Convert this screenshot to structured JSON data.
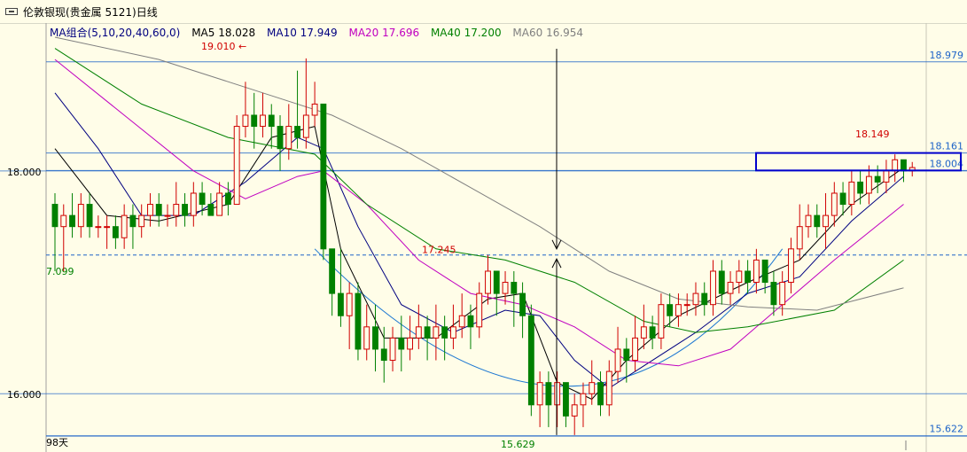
{
  "window": {
    "title": "伦敦银现(贵金属 5121)日线"
  },
  "ma_legend": [
    {
      "label": "MA组合(5,10,20,40,60,0)",
      "color": "#000080"
    },
    {
      "label": "MA5 18.028",
      "color": "#000000"
    },
    {
      "label": "MA10 17.949",
      "color": "#000080"
    },
    {
      "label": "MA20 17.696",
      "color": "#c000c0"
    },
    {
      "label": "MA40 17.200",
      "color": "#008000"
    },
    {
      "label": "MA60 16.954",
      "color": "#808080"
    }
  ],
  "colors": {
    "up": "#d00000",
    "down": "#008000",
    "grid": "#1e64c8",
    "annotation_box": "#0000cc",
    "arc": "#1e78d2"
  },
  "chart_data": {
    "type": "candlestick",
    "ylim": [
      15.62,
      19.2
    ],
    "y_ticks": [
      {
        "value": 18.0,
        "label": "18.000"
      },
      {
        "value": 16.0,
        "label": "16.000"
      }
    ],
    "right_labels": [
      {
        "value": 18.979,
        "label": "18.979",
        "color": "#1e64c8"
      },
      {
        "value": 18.161,
        "label": "18.161",
        "color": "#1e64c8"
      },
      {
        "value": 18.004,
        "label": "18.004",
        "color": "#1e64c8"
      },
      {
        "value": 15.622,
        "label": "15.622",
        "color": "#1e64c8"
      }
    ],
    "left_labels": [
      {
        "value": 17.099,
        "label": "7.099",
        "color": "#008000"
      }
    ],
    "annotations": [
      {
        "label": "19.010",
        "value": 19.01,
        "color": "#d00000"
      },
      {
        "label": "17.245",
        "value": 17.245,
        "color": "#d00000"
      },
      {
        "label": "18.149",
        "value": 18.149,
        "color": "#d00000"
      },
      {
        "label": "15.629",
        "value": 15.629,
        "color": "#008000"
      }
    ],
    "footer": "98天",
    "dashed_level": 17.245,
    "candles": [
      [
        17.7,
        17.5,
        17.8,
        17.1
      ],
      [
        17.5,
        17.6,
        17.7,
        17.1
      ],
      [
        17.6,
        17.5,
        17.8,
        17.4
      ],
      [
        17.5,
        17.7,
        17.8,
        17.4
      ],
      [
        17.7,
        17.5,
        17.8,
        17.4
      ],
      [
        17.5,
        17.5,
        17.6,
        17.4
      ],
      [
        17.5,
        17.5,
        17.6,
        17.3
      ],
      [
        17.5,
        17.4,
        17.6,
        17.3
      ],
      [
        17.4,
        17.6,
        17.7,
        17.3
      ],
      [
        17.6,
        17.5,
        17.7,
        17.3
      ],
      [
        17.5,
        17.6,
        17.7,
        17.4
      ],
      [
        17.6,
        17.7,
        17.8,
        17.5
      ],
      [
        17.7,
        17.6,
        17.8,
        17.5
      ],
      [
        17.6,
        17.6,
        17.7,
        17.5
      ],
      [
        17.6,
        17.7,
        17.9,
        17.5
      ],
      [
        17.7,
        17.6,
        17.8,
        17.5
      ],
      [
        17.6,
        17.8,
        17.9,
        17.5
      ],
      [
        17.8,
        17.7,
        17.9,
        17.6
      ],
      [
        17.7,
        17.6,
        17.8,
        17.6
      ],
      [
        17.6,
        17.8,
        17.9,
        17.6
      ],
      [
        17.8,
        17.7,
        17.9,
        17.6
      ],
      [
        17.7,
        18.4,
        18.5,
        17.7
      ],
      [
        18.4,
        18.5,
        18.8,
        18.3
      ],
      [
        18.5,
        18.4,
        18.7,
        18.2
      ],
      [
        18.4,
        18.5,
        18.7,
        18.3
      ],
      [
        18.5,
        18.4,
        18.6,
        18.2
      ],
      [
        18.4,
        18.2,
        18.5,
        18.0
      ],
      [
        18.2,
        18.4,
        18.6,
        18.1
      ],
      [
        18.4,
        18.3,
        18.9,
        18.2
      ],
      [
        18.3,
        18.5,
        19.01,
        18.2
      ],
      [
        18.5,
        18.6,
        18.8,
        18.4
      ],
      [
        18.6,
        17.3,
        18.6,
        17.2
      ],
      [
        17.3,
        16.9,
        17.3,
        16.7
      ],
      [
        16.9,
        16.7,
        17.3,
        16.6
      ],
      [
        16.7,
        16.9,
        17.0,
        16.4
      ],
      [
        16.9,
        16.4,
        17.0,
        16.3
      ],
      [
        16.4,
        16.6,
        16.8,
        16.3
      ],
      [
        16.6,
        16.4,
        16.8,
        16.2
      ],
      [
        16.4,
        16.3,
        16.6,
        16.1
      ],
      [
        16.3,
        16.5,
        16.6,
        16.2
      ],
      [
        16.5,
        16.4,
        16.7,
        16.2
      ],
      [
        16.4,
        16.5,
        16.7,
        16.3
      ],
      [
        16.5,
        16.6,
        16.8,
        16.4
      ],
      [
        16.6,
        16.5,
        16.7,
        16.3
      ],
      [
        16.5,
        16.6,
        16.8,
        16.3
      ],
      [
        16.6,
        16.5,
        16.7,
        16.3
      ],
      [
        16.5,
        16.6,
        16.8,
        16.4
      ],
      [
        16.6,
        16.7,
        16.9,
        16.5
      ],
      [
        16.7,
        16.6,
        16.8,
        16.4
      ],
      [
        16.6,
        16.9,
        17.0,
        16.5
      ],
      [
        16.9,
        17.1,
        17.245,
        16.8
      ],
      [
        17.1,
        16.9,
        17.1,
        16.7
      ],
      [
        16.9,
        17.0,
        17.1,
        16.8
      ],
      [
        17.0,
        16.9,
        17.1,
        16.6
      ],
      [
        16.9,
        16.7,
        17.0,
        16.5
      ],
      [
        16.7,
        15.9,
        16.8,
        15.8
      ],
      [
        15.9,
        16.1,
        16.2,
        15.7
      ],
      [
        16.1,
        15.9,
        16.2,
        15.7
      ],
      [
        15.9,
        16.1,
        16.2,
        15.7
      ],
      [
        16.1,
        15.8,
        16.1,
        15.7
      ],
      [
        15.8,
        15.9,
        16.0,
        15.629
      ],
      [
        15.9,
        16.0,
        16.1,
        15.7
      ],
      [
        16.0,
        16.1,
        16.3,
        15.9
      ],
      [
        16.1,
        15.9,
        16.2,
        15.8
      ],
      [
        15.9,
        16.2,
        16.3,
        15.8
      ],
      [
        16.2,
        16.4,
        16.6,
        16.1
      ],
      [
        16.4,
        16.3,
        16.5,
        16.1
      ],
      [
        16.3,
        16.5,
        16.7,
        16.2
      ],
      [
        16.5,
        16.6,
        16.8,
        16.4
      ],
      [
        16.6,
        16.5,
        16.7,
        16.4
      ],
      [
        16.5,
        16.8,
        16.9,
        16.4
      ],
      [
        16.8,
        16.7,
        16.9,
        16.6
      ],
      [
        16.7,
        16.8,
        16.9,
        16.6
      ],
      [
        16.8,
        16.8,
        16.9,
        16.7
      ],
      [
        16.8,
        16.9,
        17.0,
        16.7
      ],
      [
        16.9,
        16.8,
        17.0,
        16.7
      ],
      [
        16.8,
        17.1,
        17.2,
        16.7
      ],
      [
        17.1,
        16.9,
        17.2,
        16.8
      ],
      [
        16.9,
        17.0,
        17.1,
        16.8
      ],
      [
        17.0,
        17.1,
        17.2,
        16.9
      ],
      [
        17.1,
        17.0,
        17.2,
        16.9
      ],
      [
        17.0,
        17.2,
        17.3,
        16.9
      ],
      [
        17.2,
        17.0,
        17.2,
        16.9
      ],
      [
        17.0,
        16.8,
        17.1,
        16.7
      ],
      [
        16.8,
        17.0,
        17.1,
        16.7
      ],
      [
        17.0,
        17.3,
        17.4,
        16.9
      ],
      [
        17.3,
        17.5,
        17.7,
        17.2
      ],
      [
        17.5,
        17.6,
        17.7,
        17.4
      ],
      [
        17.6,
        17.5,
        17.7,
        17.4
      ],
      [
        17.5,
        17.6,
        17.8,
        17.3
      ],
      [
        17.6,
        17.8,
        17.9,
        17.5
      ],
      [
        17.8,
        17.7,
        17.9,
        17.6
      ],
      [
        17.7,
        17.9,
        18.0,
        17.6
      ],
      [
        17.9,
        17.8,
        18.0,
        17.7
      ],
      [
        17.8,
        17.95,
        18.05,
        17.7
      ],
      [
        17.95,
        17.9,
        18.05,
        17.8
      ],
      [
        17.9,
        18.0,
        18.1,
        17.8
      ],
      [
        18.0,
        18.1,
        18.149,
        17.9
      ],
      [
        18.1,
        18.0,
        18.1,
        17.9
      ],
      [
        18.0,
        18.03,
        18.08,
        17.95
      ]
    ],
    "ma_series": [
      {
        "name": "MA5",
        "color": "#000000",
        "points": [
          [
            0,
            18.2
          ],
          [
            6,
            17.6
          ],
          [
            12,
            17.55
          ],
          [
            20,
            17.7
          ],
          [
            25,
            18.3
          ],
          [
            30,
            18.4
          ],
          [
            33,
            17.3
          ],
          [
            38,
            16.5
          ],
          [
            44,
            16.5
          ],
          [
            50,
            16.85
          ],
          [
            54,
            16.9
          ],
          [
            58,
            16.1
          ],
          [
            62,
            15.95
          ],
          [
            66,
            16.3
          ],
          [
            72,
            16.7
          ],
          [
            80,
            17.0
          ],
          [
            86,
            17.2
          ],
          [
            92,
            17.7
          ],
          [
            98,
            18.03
          ]
        ]
      },
      {
        "name": "MA10",
        "color": "#000080",
        "points": [
          [
            0,
            18.7
          ],
          [
            5,
            18.2
          ],
          [
            10,
            17.6
          ],
          [
            16,
            17.6
          ],
          [
            22,
            17.9
          ],
          [
            28,
            18.3
          ],
          [
            31,
            18.2
          ],
          [
            35,
            17.5
          ],
          [
            40,
            16.8
          ],
          [
            46,
            16.55
          ],
          [
            52,
            16.75
          ],
          [
            56,
            16.7
          ],
          [
            60,
            16.3
          ],
          [
            64,
            16.05
          ],
          [
            68,
            16.25
          ],
          [
            74,
            16.55
          ],
          [
            80,
            16.9
          ],
          [
            86,
            17.05
          ],
          [
            92,
            17.55
          ],
          [
            98,
            17.95
          ]
        ]
      },
      {
        "name": "MA20",
        "color": "#c000c0",
        "points": [
          [
            0,
            19.0
          ],
          [
            8,
            18.5
          ],
          [
            16,
            18.0
          ],
          [
            22,
            17.75
          ],
          [
            28,
            17.95
          ],
          [
            31,
            18.0
          ],
          [
            36,
            17.7
          ],
          [
            42,
            17.2
          ],
          [
            48,
            16.9
          ],
          [
            54,
            16.8
          ],
          [
            60,
            16.6
          ],
          [
            66,
            16.3
          ],
          [
            72,
            16.25
          ],
          [
            78,
            16.4
          ],
          [
            84,
            16.8
          ],
          [
            90,
            17.2
          ],
          [
            98,
            17.7
          ]
        ]
      },
      {
        "name": "MA40",
        "color": "#008000",
        "points": [
          [
            0,
            19.1
          ],
          [
            10,
            18.6
          ],
          [
            20,
            18.3
          ],
          [
            30,
            18.15
          ],
          [
            36,
            17.7
          ],
          [
            44,
            17.3
          ],
          [
            52,
            17.2
          ],
          [
            60,
            17.0
          ],
          [
            68,
            16.65
          ],
          [
            74,
            16.55
          ],
          [
            80,
            16.6
          ],
          [
            90,
            16.75
          ],
          [
            98,
            17.2
          ]
        ]
      },
      {
        "name": "MA60",
        "color": "#808080",
        "points": [
          [
            0,
            19.2
          ],
          [
            12,
            19.0
          ],
          [
            24,
            18.7
          ],
          [
            32,
            18.5
          ],
          [
            40,
            18.2
          ],
          [
            48,
            17.85
          ],
          [
            56,
            17.5
          ],
          [
            64,
            17.1
          ],
          [
            72,
            16.85
          ],
          [
            80,
            16.78
          ],
          [
            88,
            16.75
          ],
          [
            98,
            16.95
          ]
        ]
      }
    ]
  }
}
